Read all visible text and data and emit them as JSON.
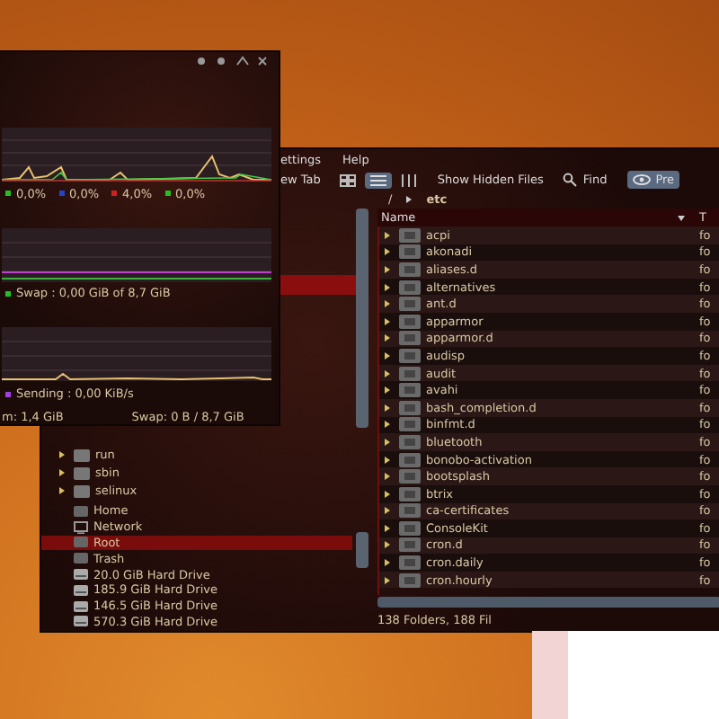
{
  "system_monitor": {
    "cpu_legend": [
      {
        "value": "0,0%",
        "color": "#22c022"
      },
      {
        "value": "0,0%",
        "color": "#2244cc"
      },
      {
        "value": "4,0%",
        "color": "#cc2222"
      },
      {
        "value": "0,0%",
        "color": "#22c022"
      }
    ],
    "memory_legend": {
      "text": "Swap : 0,00 GiB of 8,7 GiB",
      "color": "#22c022"
    },
    "network_legend": {
      "text": "Sending : 0,00 KiB/s",
      "color": "#a040e0"
    },
    "status": [
      "m: 1,4 GiB",
      "Swap: 0 B / 8,7 GiB"
    ]
  },
  "file_manager": {
    "menu": [
      "ettings",
      "Help"
    ],
    "new_tab": "ew Tab",
    "view_buttons": [
      {
        "selected": false
      },
      {
        "selected": true
      },
      {
        "selected": false
      }
    ],
    "show_hidden": "Show Hidden Files",
    "find": "Find",
    "preview": {
      "label": "Pre",
      "on": true
    },
    "breadcrumb": [
      "/",
      "etc"
    ],
    "columns": [
      "Name",
      "T"
    ],
    "rows": [
      {
        "name": "acpi",
        "type": "fo"
      },
      {
        "name": "akonadi",
        "type": "fo"
      },
      {
        "name": "aliases.d",
        "type": "fo"
      },
      {
        "name": "alternatives",
        "type": "fo"
      },
      {
        "name": "ant.d",
        "type": "fo"
      },
      {
        "name": "apparmor",
        "type": "fo"
      },
      {
        "name": "apparmor.d",
        "type": "fo"
      },
      {
        "name": "audisp",
        "type": "fo"
      },
      {
        "name": "audit",
        "type": "fo"
      },
      {
        "name": "avahi",
        "type": "fo"
      },
      {
        "name": "bash_completion.d",
        "type": "fo"
      },
      {
        "name": "binfmt.d",
        "type": "fo"
      },
      {
        "name": "bluetooth",
        "type": "fo"
      },
      {
        "name": "bonobo-activation",
        "type": "fo"
      },
      {
        "name": "bootsplash",
        "type": "fo"
      },
      {
        "name": "btrix",
        "type": "fo"
      },
      {
        "name": "ca-certificates",
        "type": "fo"
      },
      {
        "name": "ConsoleKit",
        "type": "fo"
      },
      {
        "name": "cron.d",
        "type": "fo"
      },
      {
        "name": "cron.daily",
        "type": "fo"
      },
      {
        "name": "cron.hourly",
        "type": "fo"
      }
    ],
    "tree": [
      "run",
      "sbin",
      "selinux"
    ],
    "places": [
      {
        "label": "Home",
        "kind": "place",
        "selected": false
      },
      {
        "label": "Network",
        "kind": "network",
        "selected": false
      },
      {
        "label": "Root",
        "kind": "place",
        "selected": true
      },
      {
        "label": "Trash",
        "kind": "place",
        "selected": false
      },
      {
        "label": "20.0 GiB Hard Drive",
        "kind": "drive",
        "selected": false
      },
      {
        "label": "185.9 GiB Hard Drive",
        "kind": "drive",
        "selected": false
      },
      {
        "label": "146.5 GiB Hard Drive",
        "kind": "drive",
        "selected": false
      },
      {
        "label": "570.3 GiB Hard Drive",
        "kind": "drive",
        "selected": false
      }
    ],
    "status": "138 Folders, 188 Fil"
  }
}
